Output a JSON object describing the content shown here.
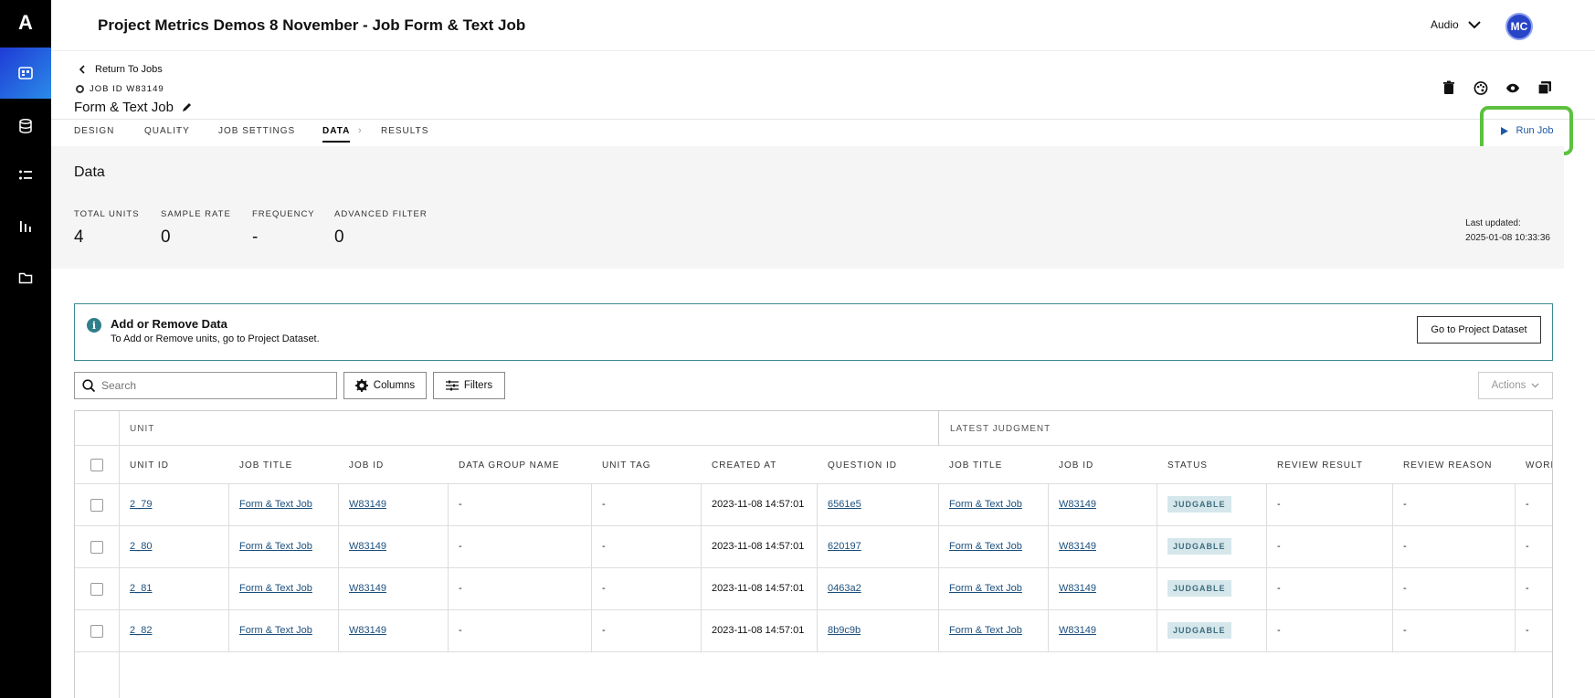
{
  "app": {
    "logo": "A",
    "title": "Project Metrics Demos 8 November - Job Form & Text Job"
  },
  "topbar": {
    "audio_label": "Audio",
    "avatar_initials": "MC"
  },
  "sidebar": {
    "items": [
      {
        "icon": "projects-icon",
        "active": true
      },
      {
        "icon": "database-icon",
        "active": false
      },
      {
        "icon": "list-icon",
        "active": false
      },
      {
        "icon": "chart-icon",
        "active": false
      },
      {
        "icon": "folder-icon",
        "active": false
      }
    ]
  },
  "job": {
    "back_label": "Return To Jobs",
    "id_label": "JOB ID W83149",
    "name": "Form & Text Job"
  },
  "tabs": [
    "DESIGN",
    "QUALITY",
    "JOB SETTINGS",
    "DATA",
    "RESULTS"
  ],
  "active_tab": "DATA",
  "run_job_label": "Run Job",
  "data_section": {
    "heading": "Data",
    "stats": [
      {
        "label": "TOTAL UNITS",
        "value": "4"
      },
      {
        "label": "SAMPLE RATE",
        "value": "0"
      },
      {
        "label": "FREQUENCY",
        "value": "-"
      },
      {
        "label": "ADVANCED FILTER",
        "value": "0"
      }
    ],
    "last_updated_label": "Last updated:",
    "last_updated_value": "2025-01-08 10:33:36"
  },
  "info_banner": {
    "title": "Add or Remove Data",
    "text": "To Add or Remove units, go to Project Dataset.",
    "button": "Go to Project Dataset",
    "icon_glyph": "i"
  },
  "toolbar": {
    "search_placeholder": "Search",
    "columns_label": "Columns",
    "filters_label": "Filters",
    "actions_label": "Actions"
  },
  "table": {
    "groups": [
      "UNIT",
      "LATEST JUDGMENT"
    ],
    "columns": [
      "UNIT ID",
      "JOB TITLE",
      "JOB ID",
      "DATA GROUP NAME",
      "UNIT TAG",
      "CREATED AT",
      "QUESTION ID",
      "JOB TITLE",
      "JOB ID",
      "STATUS",
      "REVIEW RESULT",
      "REVIEW REASON",
      "WORK"
    ],
    "rows": [
      [
        "2_79",
        "Form & Text Job",
        "W83149",
        "-",
        "-",
        "2023-11-08 14:57:01",
        "6561e5",
        "Form & Text Job",
        "W83149",
        "JUDGABLE",
        "-",
        "-",
        "-"
      ],
      [
        "2_80",
        "Form & Text Job",
        "W83149",
        "-",
        "-",
        "2023-11-08 14:57:01",
        "620197",
        "Form & Text Job",
        "W83149",
        "JUDGABLE",
        "-",
        "-",
        "-"
      ],
      [
        "2_81",
        "Form & Text Job",
        "W83149",
        "-",
        "-",
        "2023-11-08 14:57:01",
        "0463a2",
        "Form & Text Job",
        "W83149",
        "JUDGABLE",
        "-",
        "-",
        "-"
      ],
      [
        "2_82",
        "Form & Text Job",
        "W83149",
        "-",
        "-",
        "2023-11-08 14:57:01",
        "8b9c9b",
        "Form & Text Job",
        "W83149",
        "JUDGABLE",
        "-",
        "-",
        "-"
      ]
    ]
  },
  "colors": {
    "accent": "#1f3bd6",
    "highlight": "#5cc13e",
    "link": "#1c4f7c",
    "badge_bg": "#d6e7ec"
  }
}
